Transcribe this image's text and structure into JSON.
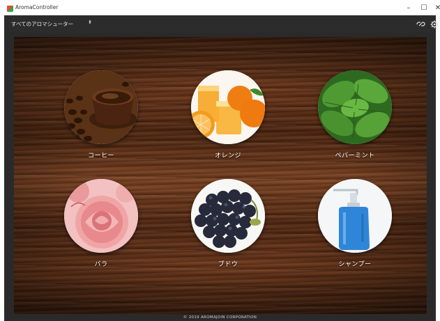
{
  "window": {
    "title": "AromaController",
    "minimize_glyph": "–",
    "maximize_glyph": "☐",
    "close_glyph": "✕"
  },
  "toolbar": {
    "device_select_value": "すべてのアロマシューター",
    "device_select_caret": "⬍",
    "link_icon": "link-icon",
    "settings_icon": "gear-icon"
  },
  "scents": [
    {
      "label": "コーヒー",
      "icon": "coffee-image"
    },
    {
      "label": "オレンジ",
      "icon": "orange-image"
    },
    {
      "label": "ペパーミント",
      "icon": "peppermint-image"
    },
    {
      "label": "バラ",
      "icon": "rose-image"
    },
    {
      "label": "ブドウ",
      "icon": "grape-image"
    },
    {
      "label": "シャンプー",
      "icon": "shampoo-image"
    }
  ],
  "footer": {
    "copyright": "© 2019 AROMAJOIN CORPORATION"
  }
}
